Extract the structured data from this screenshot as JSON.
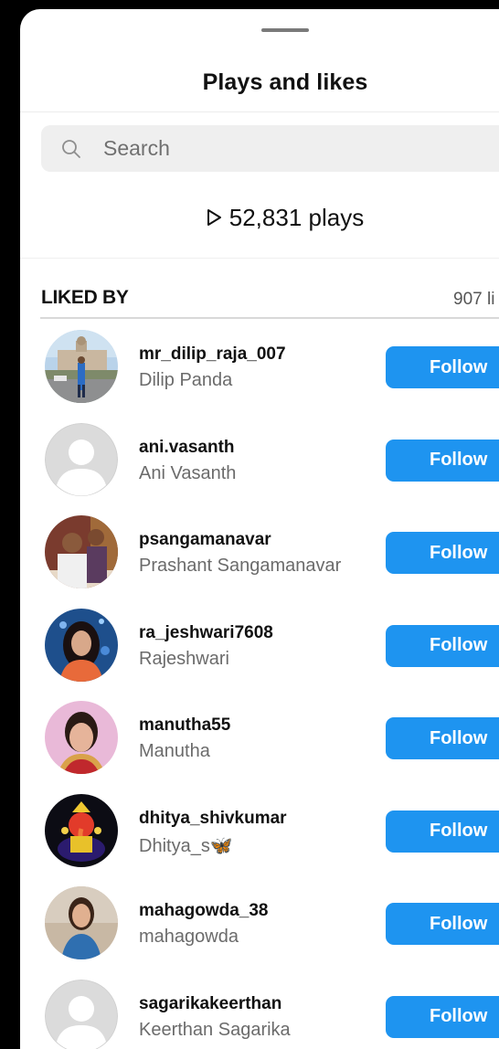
{
  "sheet": {
    "title": "Plays and likes"
  },
  "search": {
    "placeholder": "Search",
    "value": ""
  },
  "plays": {
    "text": "52,831 plays"
  },
  "likes": {
    "header": "LIKED BY",
    "count_text": "907 li"
  },
  "follow_label": "Follow",
  "users": [
    {
      "username": "mr_dilip_raja_007",
      "fullname": "Dilip Panda",
      "avatar": "photo-building"
    },
    {
      "username": "ani.vasanth",
      "fullname": "Ani Vasanth",
      "avatar": "default"
    },
    {
      "username": "psangamanavar",
      "fullname": "Prashant Sangamanavar",
      "avatar": "photo-two-people"
    },
    {
      "username": "ra_jeshwari7608",
      "fullname": "Rajeshwari",
      "avatar": "photo-woman-blue"
    },
    {
      "username": "manutha55",
      "fullname": "Manutha",
      "avatar": "photo-woman-pink"
    },
    {
      "username": "dhitya_shivkumar",
      "fullname": "Dhitya_s🦋",
      "avatar": "photo-ganesha"
    },
    {
      "username": "mahagowda_38",
      "fullname": "mahagowda",
      "avatar": "photo-woman-outdoor"
    },
    {
      "username": "sagarikakeerthan",
      "fullname": "Keerthan Sagarika",
      "avatar": "default"
    }
  ],
  "colors": {
    "accent": "#1e94f0",
    "background": "#ffffff",
    "search_bg": "#efefef",
    "muted_text": "#6b6b6b"
  }
}
